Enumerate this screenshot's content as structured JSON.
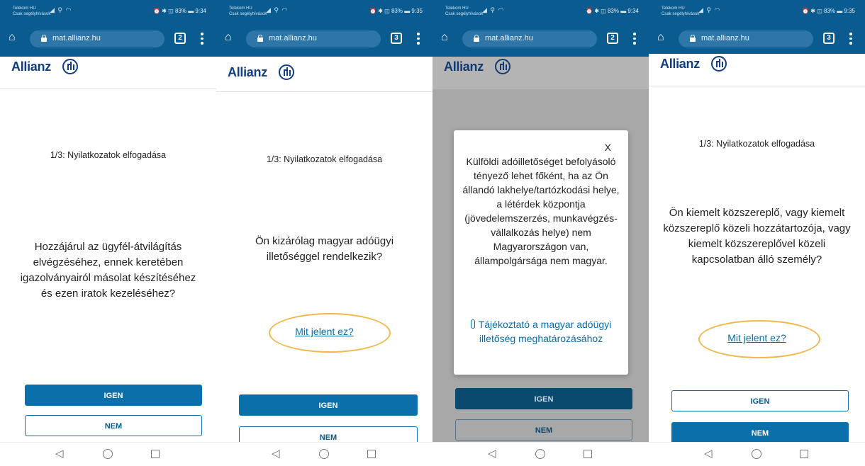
{
  "screens": [
    {
      "status": {
        "carrier_1": "Telekom HU",
        "carrier_2": "Csak segélyhívások",
        "right": "⏰ ✱ ◫ 83% ▬ 9:34"
      },
      "browser": {
        "url": "mat.allianz.hu",
        "tab_count": "2"
      },
      "brand": "Allianz",
      "step": "1/3: Nyilatkozatok elfogadása",
      "question": "Hozzájárul az ügyfél-átvilágítás elvégzéséhez, ennek keretében igazolványairól másolat készítéséhez és ezen iratok kezeléséhez?",
      "yes": "IGEN",
      "no": "NEM"
    },
    {
      "status": {
        "carrier_1": "Telekom HU",
        "carrier_2": "Csak segélyhívások",
        "right": "⏰ ✱ ◫ 83% ▬ 9:35"
      },
      "browser": {
        "url": "mat.allianz.hu",
        "tab_count": "3"
      },
      "brand": "Allianz",
      "step": "1/3: Nyilatkozatok elfogadása",
      "question": "Ön kizárólag magyar adóügyi illetőséggel rendelkezik?",
      "link": "Mit jelent ez?",
      "yes": "IGEN",
      "no": "NEM"
    },
    {
      "status": {
        "carrier_1": "Telekom HU",
        "carrier_2": "Csak segélyhívások",
        "right": "⏰ ✱ ◫ 83% ▬ 9:34"
      },
      "browser": {
        "url": "mat.allianz.hu",
        "tab_count": "2"
      },
      "brand": "Allianz",
      "modal": {
        "close": "X",
        "text": "Külföldi adóilletőséget befolyásoló tényező lehet főként, ha az Ön állandó lakhelye/tartózkodási helye, a létérdek központja (jövedelemszerzés, munkavégzés-vállalkozás helye) nem Magyarországon van, állampolgársága nem magyar.",
        "link": "Tájékoztató a magyar adóügyi illetőség meghatározásához"
      },
      "yes": "IGEN",
      "no": "NEM"
    },
    {
      "status": {
        "carrier_1": "Telekom HU",
        "carrier_2": "Csak segélyhívások",
        "right": "⏰ ✱ ◫ 83% ▬ 9:35"
      },
      "browser": {
        "url": "mat.allianz.hu",
        "tab_count": "3"
      },
      "brand": "Allianz",
      "step": "1/3: Nyilatkozatok elfogadása",
      "question": "Ön kiemelt közszereplő, vagy kiemelt közszereplő közeli hozzátartozója, vagy kiemelt közszereplővel közeli kapcsolatban álló személy?",
      "link": "Mit jelent ez?",
      "yes": "IGEN",
      "no": "NEM"
    }
  ],
  "colors": {
    "header": "#0a5b8f",
    "primary": "#0b6fa9",
    "brand": "#113e82",
    "highlight": "#f0b84a",
    "overlay": "#a8a8a8"
  },
  "icons": [
    "home-icon",
    "lock-icon",
    "tabs-icon",
    "menu-icon",
    "allianz-logo-icon",
    "back-icon",
    "home-circle-icon",
    "recent-apps-icon",
    "paperclip-icon",
    "close-icon"
  ]
}
